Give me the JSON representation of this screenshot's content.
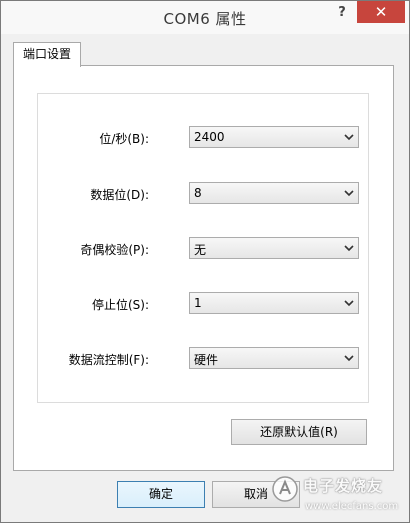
{
  "window": {
    "title": "COM6 属性",
    "help_label": "?",
    "close_label": "✕"
  },
  "tabs": [
    {
      "label": "端口设置"
    }
  ],
  "fields": [
    {
      "label": "位/秒(B):",
      "value": "2400"
    },
    {
      "label": "数据位(D):",
      "value": "8"
    },
    {
      "label": "奇偶校验(P):",
      "value": "无"
    },
    {
      "label": "停止位(S):",
      "value": "1"
    },
    {
      "label": "数据流控制(F):",
      "value": "硬件"
    }
  ],
  "buttons": {
    "restore_defaults": "还原默认值(R)",
    "ok": "确定",
    "cancel": "取消"
  },
  "watermark": {
    "text": "电子发烧友",
    "url": "www.elecfans.com"
  }
}
